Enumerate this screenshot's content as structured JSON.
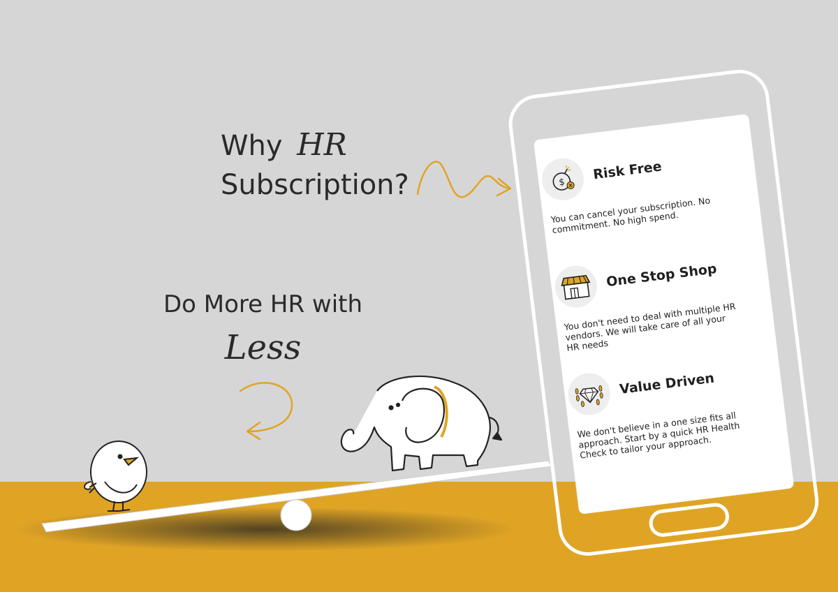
{
  "headline": {
    "why": "Why",
    "hr": "HR",
    "subscription": "Subscription?"
  },
  "tagline": {
    "main": "Do More HR with",
    "emphasis": "Less"
  },
  "features": [
    {
      "icon": "money-bomb-icon",
      "title": "Risk Free",
      "description": "You can cancel your subscription. No commitment. No high spend."
    },
    {
      "icon": "storefront-icon",
      "title": "One Stop Shop",
      "description": "You don't need to deal with multiple HR vendors. We will take care of all your HR needs"
    },
    {
      "icon": "diamond-laurel-icon",
      "title": "Value Driven",
      "description": "We don't believe in a one size fits all approach. Start by a quick HR Health Check to tailor your approach."
    }
  ],
  "colors": {
    "background": "#d6d6d6",
    "accent": "#e0a425",
    "text": "#2a2a2a",
    "phone_outline": "#ffffff"
  }
}
